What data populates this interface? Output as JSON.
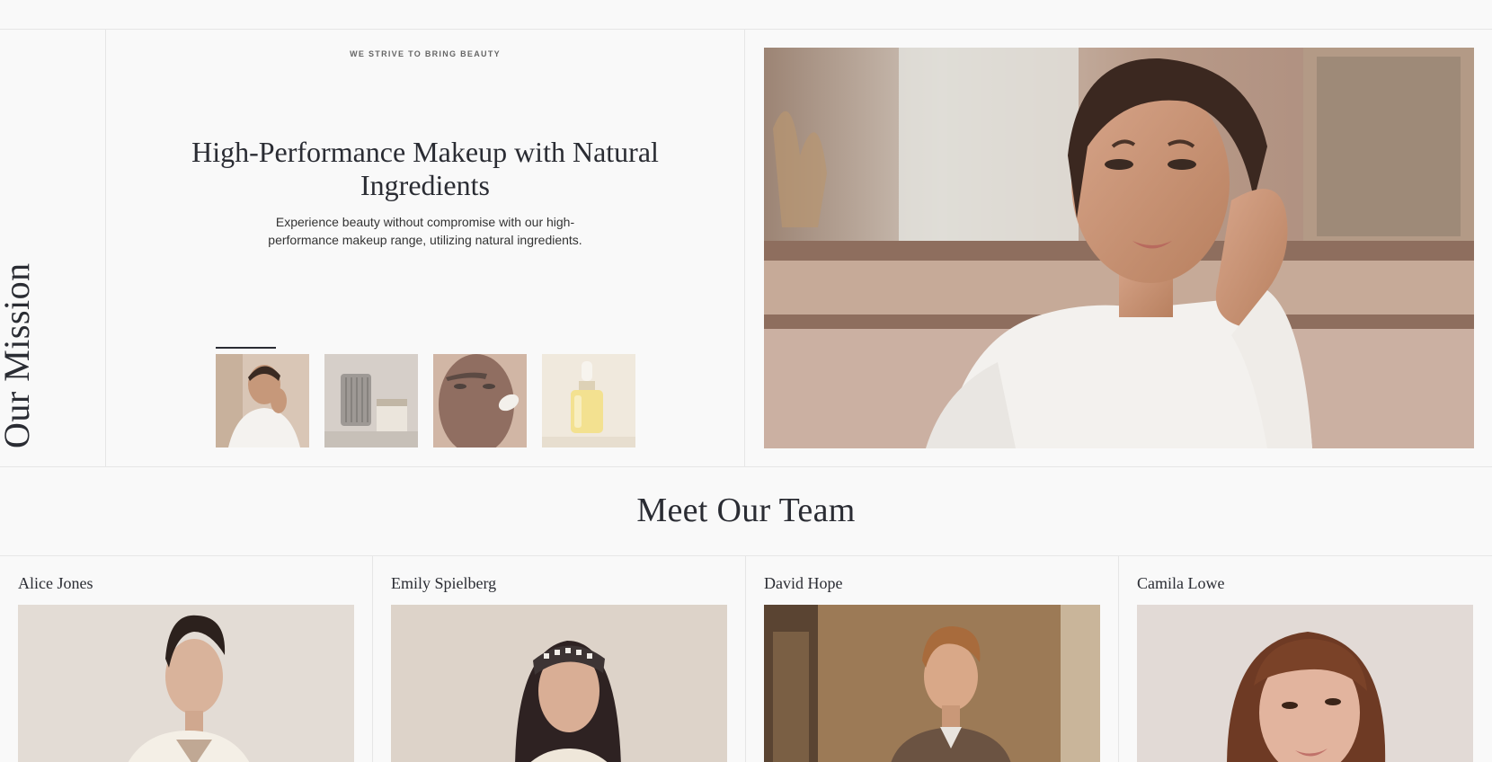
{
  "mission": {
    "side_title": "Our Mission",
    "eyebrow": "WE STRIVE TO BRING BEAUTY",
    "headline": "High-Performance Makeup with Natural Ingredients",
    "description": "Experience beauty without compromise with our high-performance makeup range, utilizing natural ingredients.",
    "thumbnails": [
      {
        "subject": "model-in-white-robe",
        "active": true
      },
      {
        "subject": "ribbed-glass-jars",
        "active": false
      },
      {
        "subject": "face-with-cream",
        "active": false
      },
      {
        "subject": "serum-dropper-bottle",
        "active": false
      }
    ]
  },
  "team": {
    "heading": "Meet Our Team",
    "members": [
      {
        "name": "Alice Jones"
      },
      {
        "name": "Emily Spielberg"
      },
      {
        "name": "David Hope"
      },
      {
        "name": "Camila Lowe"
      }
    ]
  }
}
